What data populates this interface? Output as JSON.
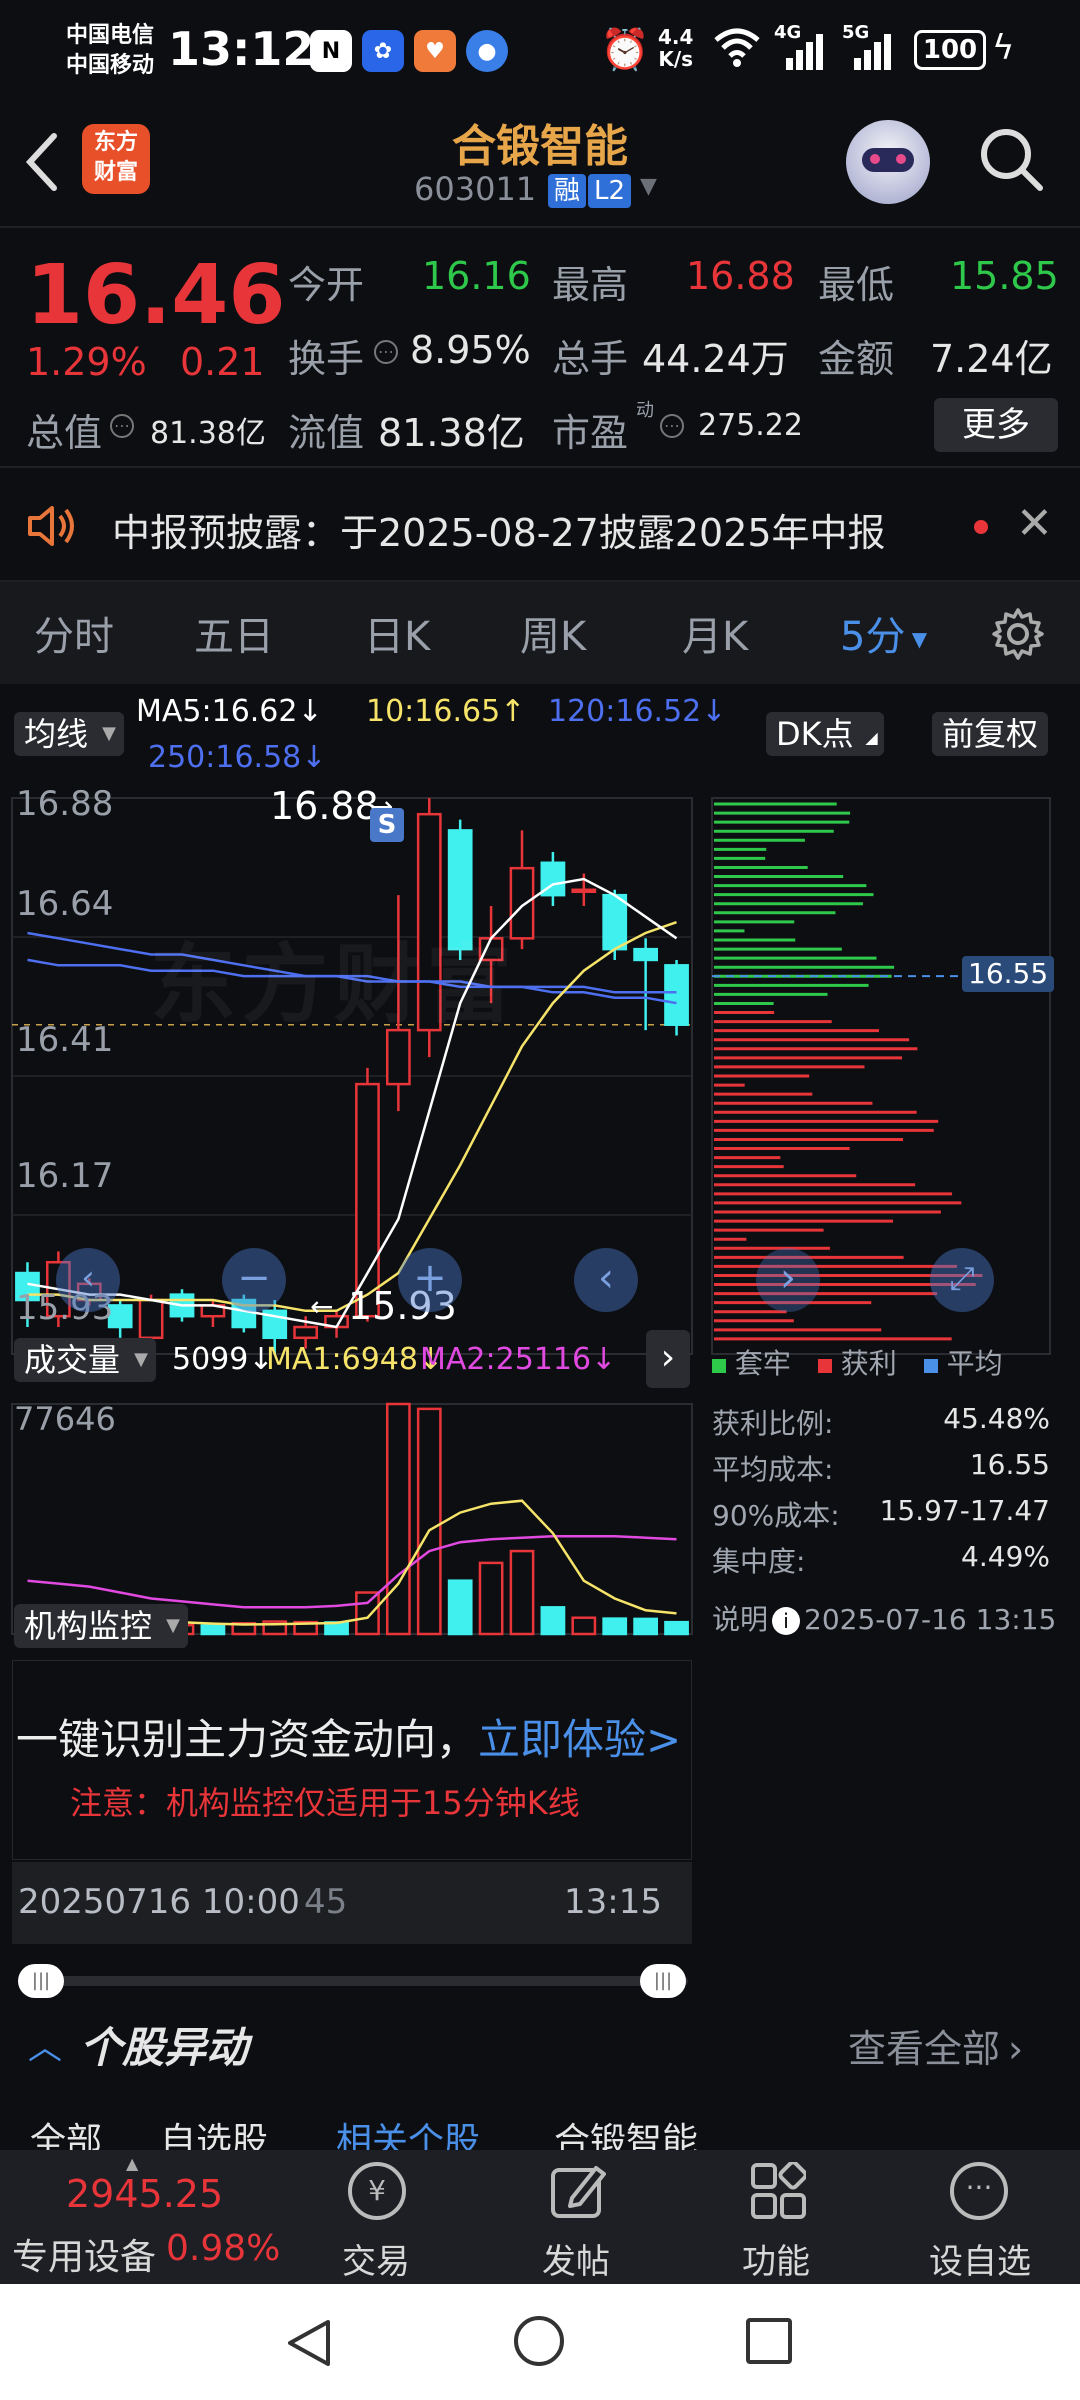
{
  "status": {
    "carrier1": "中国电信",
    "carrier2": "中国移动",
    "time": "13:12",
    "net_speed_top": "4.4",
    "net_speed_bottom": "K/s",
    "signal1": "4G",
    "signal2": "5G",
    "battery": "100"
  },
  "header": {
    "logo_line1": "东方",
    "logo_line2": "财富",
    "stock_name": "合锻智能",
    "stock_code": "603011",
    "tag_rong": "融",
    "tag_l2": "L2"
  },
  "quote": {
    "price": "16.46",
    "change_pct": "1.29%",
    "change_amt": "0.21",
    "open_label": "今开",
    "open": "16.16",
    "high_label": "最高",
    "high": "16.88",
    "low_label": "最低",
    "low": "15.85",
    "turnover_label": "换手",
    "turnover": "8.95%",
    "volume_label": "总手",
    "volume": "44.24万",
    "amount_label": "金额",
    "amount": "7.24亿",
    "mktcap_label": "总值",
    "mktcap": "81.38亿",
    "float_label": "流值",
    "float": "81.38亿",
    "pe_label": "市盈",
    "pe_sup": "动",
    "pe": "275.22",
    "more": "更多"
  },
  "notice": {
    "text": "中报预披露：于2025-08-27披露2025年中报"
  },
  "tabs": [
    "分时",
    "五日",
    "日K",
    "周K",
    "月K",
    "5分"
  ],
  "ma_bar": {
    "indicator": "均线",
    "ma5": "MA5:16.62↓",
    "ma10": "10:16.65↑",
    "ma120": "120:16.52↓",
    "ma250": "250:16.58↓",
    "dk": "DK点",
    "adjust": "前复权"
  },
  "price_axis": [
    "16.88",
    "16.64",
    "16.41",
    "16.17",
    "15.93"
  ],
  "price_marks": {
    "high": "16.88",
    "low": "15.93",
    "s_badge": "S"
  },
  "watermark": "东方财富",
  "chip_price": "16.55",
  "colors": {
    "up": "#e8353a",
    "down": "#3ff0ee",
    "ma5": "#ffffff",
    "ma10": "#f5e36a",
    "ma120": "#4d6ff0",
    "ma250": "#4d6ff0",
    "chip_profit": "#e8353a",
    "chip_loss": "#2ec84b",
    "accent": "#4a8fe8"
  },
  "chart_data": {
    "type": "candlestick",
    "ylim": [
      15.85,
      16.88
    ],
    "candles": [
      {
        "o": 16.0,
        "c": 15.95,
        "h": 16.02,
        "l": 15.9
      },
      {
        "o": 15.92,
        "c": 16.02,
        "h": 16.04,
        "l": 15.9
      },
      {
        "o": 15.95,
        "c": 15.98,
        "h": 15.99,
        "l": 15.94
      },
      {
        "o": 15.94,
        "c": 15.9,
        "h": 15.95,
        "l": 15.88
      },
      {
        "o": 15.88,
        "c": 15.95,
        "h": 15.96,
        "l": 15.87
      },
      {
        "o": 15.96,
        "c": 15.92,
        "h": 15.97,
        "l": 15.91
      },
      {
        "o": 15.92,
        "c": 15.94,
        "h": 15.95,
        "l": 15.9
      },
      {
        "o": 15.95,
        "c": 15.9,
        "h": 15.96,
        "l": 15.89
      },
      {
        "o": 15.93,
        "c": 15.88,
        "h": 15.95,
        "l": 15.85
      },
      {
        "o": 15.88,
        "c": 15.9,
        "h": 15.92,
        "l": 15.86
      },
      {
        "o": 15.9,
        "c": 15.92,
        "h": 15.93,
        "l": 15.88
      },
      {
        "o": 15.92,
        "c": 16.35,
        "h": 16.38,
        "l": 15.91
      },
      {
        "o": 16.35,
        "c": 16.45,
        "h": 16.7,
        "l": 16.3
      },
      {
        "o": 16.45,
        "c": 16.85,
        "h": 16.88,
        "l": 16.4
      },
      {
        "o": 16.82,
        "c": 16.6,
        "h": 16.84,
        "l": 16.58
      },
      {
        "o": 16.58,
        "c": 16.62,
        "h": 16.68,
        "l": 16.5
      },
      {
        "o": 16.62,
        "c": 16.75,
        "h": 16.82,
        "l": 16.6
      },
      {
        "o": 16.76,
        "c": 16.7,
        "h": 16.78,
        "l": 16.68
      },
      {
        "o": 16.71,
        "c": 16.71,
        "h": 16.74,
        "l": 16.68
      },
      {
        "o": 16.7,
        "c": 16.6,
        "h": 16.71,
        "l": 16.58
      },
      {
        "o": 16.6,
        "c": 16.58,
        "h": 16.62,
        "l": 16.45
      },
      {
        "o": 16.57,
        "c": 16.46,
        "h": 16.58,
        "l": 16.44
      }
    ],
    "ma5": [
      15.98,
      15.97,
      15.96,
      15.96,
      15.95,
      15.94,
      15.94,
      15.93,
      15.92,
      15.91,
      15.9,
      16.0,
      16.1,
      16.3,
      16.5,
      16.62,
      16.68,
      16.72,
      16.73,
      16.7,
      16.66,
      16.62
    ],
    "ma10": [
      15.96,
      15.96,
      15.95,
      15.95,
      15.95,
      15.95,
      15.95,
      15.94,
      15.94,
      15.93,
      15.93,
      15.96,
      16.0,
      16.1,
      16.2,
      16.31,
      16.42,
      16.5,
      16.56,
      16.6,
      16.63,
      16.65
    ],
    "ma120": [
      16.58,
      16.57,
      16.57,
      16.57,
      16.56,
      16.56,
      16.56,
      16.55,
      16.55,
      16.55,
      16.55,
      16.55,
      16.54,
      16.54,
      16.54,
      16.53,
      16.53,
      16.53,
      16.53,
      16.52,
      16.52,
      16.52
    ],
    "ma250": [
      16.63,
      16.62,
      16.61,
      16.6,
      16.59,
      16.59,
      16.58,
      16.57,
      16.56,
      16.55,
      16.55,
      16.54,
      16.54,
      16.54,
      16.53,
      16.53,
      16.53,
      16.52,
      16.52,
      16.51,
      16.51,
      16.5
    ]
  },
  "volume_bar": {
    "label": "成交量",
    "vol": "5099↓",
    "ma1": "MA1:6948↓",
    "ma2": "MA2:25116↓",
    "axis_max": "77646"
  },
  "volume_data": {
    "ylim": [
      0,
      77646
    ],
    "bars": [
      7000,
      5000,
      4500,
      3800,
      2500,
      3000,
      2800,
      3600,
      4200,
      4000,
      3900,
      14000,
      77646,
      76000,
      18000,
      24000,
      28000,
      9000,
      5500,
      5200,
      5099,
      4000
    ],
    "up": [
      1,
      0,
      0,
      0,
      0,
      1,
      0,
      1,
      1,
      1,
      0,
      1,
      1,
      1,
      0,
      1,
      1,
      0,
      1,
      0,
      0,
      0
    ],
    "ma1": [
      9000,
      8000,
      7000,
      6500,
      5000,
      4000,
      3500,
      3200,
      3300,
      3500,
      3700,
      5500,
      17000,
      35000,
      41000,
      44000,
      45000,
      34000,
      18000,
      12000,
      8000,
      6948
    ],
    "ma2": [
      18000,
      17000,
      16000,
      14000,
      12000,
      11000,
      10000,
      9000,
      9000,
      9000,
      9500,
      10500,
      20000,
      28000,
      31000,
      32000,
      32500,
      33000,
      33000,
      33000,
      32500,
      32000
    ]
  },
  "chip": {
    "legend": [
      "套牢",
      "获利",
      "平均"
    ],
    "rows": [
      {
        "label": "获利比例:",
        "value": "45.48%"
      },
      {
        "label": "平均成本:",
        "value": "16.55"
      },
      {
        "label": "90%成本:",
        "value": "15.97-17.47"
      },
      {
        "label": "集中度:",
        "value": "4.49%"
      }
    ],
    "note": "说明",
    "date": "2025-07-16 13:15"
  },
  "monitor": {
    "label": "机构监控",
    "line1": "一键识别主力资金动向，",
    "link": "立即体验>",
    "warn": "注意：机构监控仅适用于15分钟K线"
  },
  "timeaxis": {
    "start": "20250716 10:00",
    "mid": "45",
    "end": "13:15"
  },
  "news": {
    "title": "个股异动",
    "view_all": "查看全部",
    "subtabs": [
      "全部",
      "自选股",
      "相关个股",
      "合锻智能"
    ]
  },
  "bottom": {
    "index_value": "2945.25",
    "index_name": "专用设备",
    "index_pct": "0.98%",
    "items": [
      "交易",
      "发帖",
      "功能",
      "设自选"
    ]
  }
}
